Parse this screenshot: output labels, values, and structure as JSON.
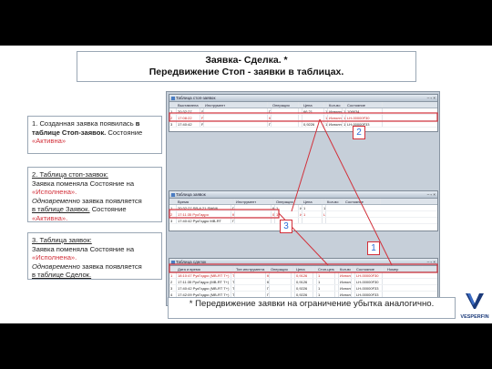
{
  "title": {
    "line1": "Заявка- Сделка. *",
    "line2": "Передвижение Стоп - заявки в таблицах."
  },
  "notes": {
    "n1": {
      "plain": "1. Созданная заявка появилась ",
      "bold": "в таблице Стоп-заявок.",
      "tail": " Состояние ",
      "red": "«Активна»"
    },
    "n2": {
      "line1": "2. Таблица стоп-заявок:",
      "line2": "Заявка поменяла Состояние на",
      "red": "«Исполнена».",
      "italic": "Одновременно",
      "mid": " заявка появляется ",
      "underline": "в таблице Заявок.",
      "tail": " Состояние",
      "red2": "«Активна»."
    },
    "n3": {
      "line1": "3. Таблица заявок:",
      "line2": "Заявка поменяла Состояние на",
      "red": "«Исполнена».",
      "italic": "Одновременно",
      "mid": " заявка появляется ",
      "underline": "в таблице Сделок."
    }
  },
  "stop_orders": {
    "title": "Таблица стоп-заявок",
    "columns": [
      "",
      "Выставлена (время)",
      "",
      "Инструмент",
      "",
      "Операция",
      "",
      "Цена",
      "",
      "Кол-во",
      "",
      "Состояние"
    ],
    "rows": [
      [
        "1",
        "20:32:27",
        "SR-6.21 SM6/6 (Фьючерсы ФО)",
        "",
        "Продажа",
        "",
        "",
        "66,21",
        "1",
        "Исполнена",
        "1",
        "106634"
      ],
      [
        "2",
        "17:08:22",
        "РусГидро (MB-RT Т+ Акции и ДР)",
        "",
        "Купля",
        "",
        "",
        "",
        "1",
        "Исполнена",
        "1",
        "LH-00000F30"
      ],
      [
        "3",
        "17:40:42",
        "РусГидро (MB-RT Т+ Акции и ДР)",
        "",
        "Продажа",
        "",
        "",
        "0,9226",
        "1",
        "Исполнена",
        "1",
        "LH-00000F33"
      ]
    ]
  },
  "orders": {
    "title": "Таблица заявок",
    "columns": [
      "",
      "Время",
      "",
      "Инструмент",
      "",
      "Операция",
      "",
      "Цена",
      "",
      "Кол-во",
      "Состояние"
    ],
    "rows": [
      [
        "1",
        "20:32:27 SR-6.21 SM6/6",
        "Продажа",
        "",
        "66,21",
        "1",
        "Исполнена",
        "1",
        "106634"
      ],
      [
        "2",
        "17:11:35 РусГидро",
        "Купля",
        "",
        "0,9126",
        "1",
        "Исполнена",
        "1",
        "LH-00000F30"
      ],
      [
        "3",
        "17:40:42 РусГидро MB-RT",
        "Продажа",
        "",
        "",
        "",
        "",
        "",
        ""
      ]
    ]
  },
  "trades": {
    "title": "Таблица сделок",
    "columns": [
      "",
      "Дата и время",
      "",
      "Тип инструмента",
      "",
      "Операция",
      "",
      "Цена",
      "",
      "Стоп-цена",
      "",
      "Кол-во",
      "",
      "Состояние",
      "",
      "Номер"
    ],
    "rows": [
      [
        "1",
        "18:10:47 РусГидро (MB-RT Т+)",
        "Т+ Акции и ДР",
        "",
        "Купля",
        "",
        "",
        "0,9126",
        "",
        "1",
        "",
        "Исполнена",
        "",
        "LH-00000F30"
      ],
      [
        "2",
        "17:11:35 РусГидро (MB-RT Т+)",
        "Т+ Акции и ДР",
        "",
        "Купля",
        "",
        "",
        "0,9126",
        "",
        "1",
        "",
        "Исполнена",
        "",
        "LH-00000F30"
      ],
      [
        "3",
        "17:40:42 РусГидро (MB-RT Т+)",
        "Т+ Акции и ДР",
        "",
        "Продажа",
        "",
        "",
        "0,9226",
        "",
        "1",
        "",
        "Исполнена",
        "",
        "LH-00000F33"
      ],
      [
        "4",
        "17:42:09 РусГидро (MB-RT Т+)",
        "Т+ Акции и ДР",
        "",
        "Продажа",
        "",
        "",
        "0,9226",
        "",
        "1",
        "",
        "Исполнена",
        "",
        "LH-00000F33"
      ],
      [
        "5",
        "17:42:09 РусГидро (MB-RT Т+)",
        "Т+ Акции и ДР",
        "",
        "Продажа",
        "",
        "",
        "0,9226",
        "",
        "1",
        "",
        "Исполнена",
        "",
        "LH-00000F33"
      ]
    ]
  },
  "badges": {
    "b1": "1",
    "b2": "2",
    "b3": "3"
  },
  "footnote": "* Передвижение заявки на ограничение убытка аналогично.",
  "logo": {
    "brand": "VESPERFIN"
  },
  "colors": {
    "accent_red": "#d2303a",
    "badge_text": "#2b6cd6",
    "logo_blue": "#1b3a7a"
  },
  "icons": {
    "window_buttons": "minimize-maximize-close-icons",
    "logo": "vesperfin-v-logo"
  }
}
